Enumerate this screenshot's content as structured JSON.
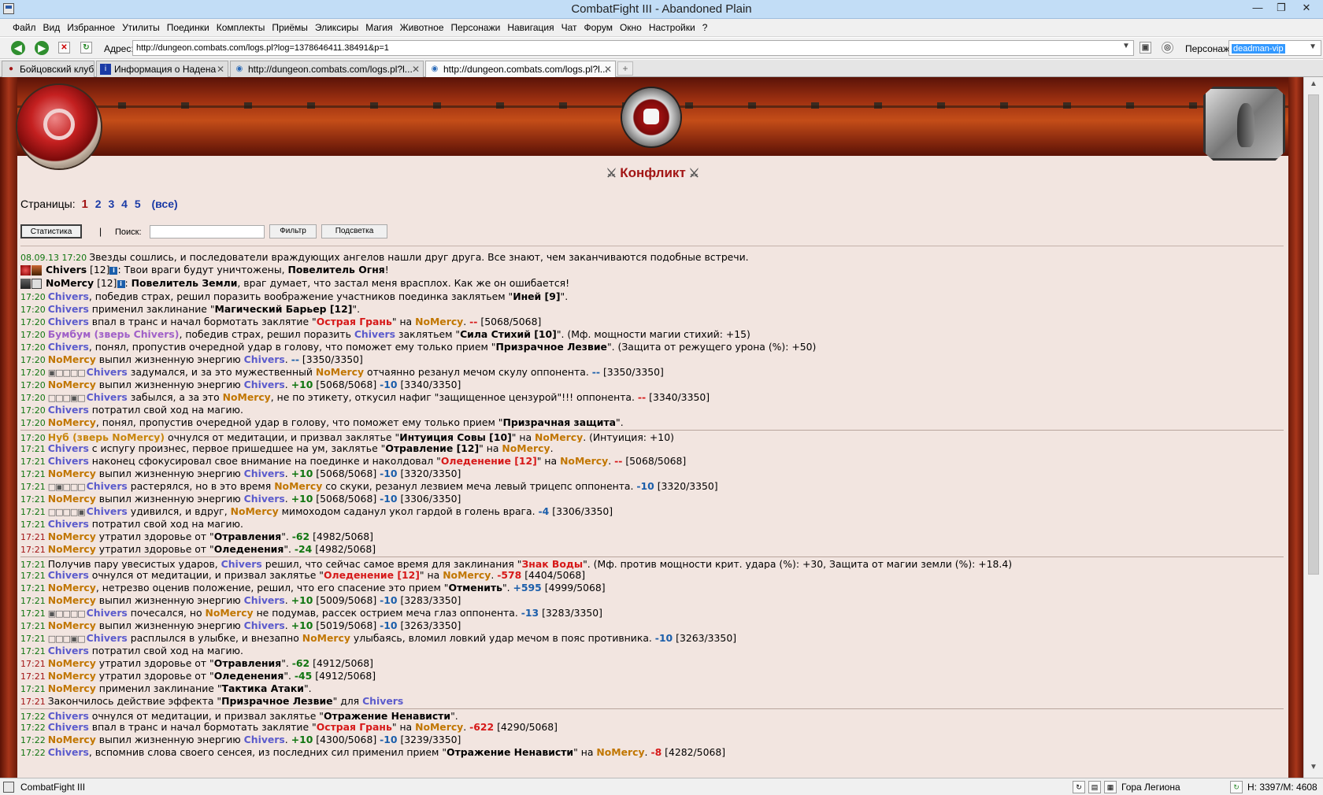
{
  "window": {
    "title": "CombatFight III - Abandoned Plain"
  },
  "menu": [
    "Файл",
    "Вид",
    "Избранное",
    "Утилиты",
    "Поединки",
    "Комплекты",
    "Приёмы",
    "Эликсиры",
    "Магия",
    "Животное",
    "Персонажи",
    "Навигация",
    "Чат",
    "Форум",
    "Окно",
    "Настройки",
    "?"
  ],
  "address": {
    "label": "Адрес:",
    "url": "http://dungeon.combats.com/logs.pl?log=1378646411.38491&p=1"
  },
  "persona": {
    "label": "Персонаж:",
    "value": "deadman-vip"
  },
  "tabs": [
    {
      "label": "Бойцовский клуб",
      "icon": "fist-icon"
    },
    {
      "label": "Информация о Надена",
      "icon": "info-icon"
    },
    {
      "label": "http://dungeon.combats.com/logs.pl?l...",
      "icon": "globe-icon"
    },
    {
      "label": "http://dungeon.combats.com/logs.pl?l...",
      "icon": "globe-icon"
    }
  ],
  "page": {
    "heading": "Конфликт",
    "pages_label": "Страницы:",
    "current_page": "1",
    "pages": [
      "2",
      "3",
      "4",
      "5"
    ],
    "all_pages": "(все)",
    "buttons": {
      "stats": "Статистика",
      "divider": "|",
      "search_label": "Поиск:",
      "filter": "Фильтр",
      "highlight": "Подсветка"
    },
    "search_value": ""
  },
  "log": {
    "first": {
      "ts": "08.09.13 17:20",
      "msg": "Звезды сошлись, и последователи враждующих ангелов нашли друг друга. Все знают, чем заканчиваются подобные встречи.",
      "chivers": {
        "name": "Chivers",
        "level": "[12]",
        "text1": ": Твои враги будут уничтожены, ",
        "title": "Повелитель Огня",
        "end": "!"
      },
      "nomercy": {
        "name": "NoMercy",
        "level": "[12]",
        "text1": ": ",
        "title": "Повелитель Земли",
        "text2": ", враг думает, что застал меня врасплох. Как же он ошибается!"
      }
    },
    "r1": {
      "t": "17:20",
      "a": "Chivers",
      "b": ", победив страх, решил поразить воображение участников поединка заклятьем \"",
      "c": "Иней [9]",
      "d": "\"."
    },
    "r2": {
      "t": "17:20",
      "a": "Chivers",
      "b": " применил заклинание \"",
      "c": "Магический Барьер [12]",
      "d": "\"."
    },
    "r3": {
      "t": "17:20",
      "a": "Chivers",
      "b": " впал в транс и начал бормотать заклятие \"",
      "c": "Острая Грань",
      "d": "\" на ",
      "e": "NoMercy",
      "f": ". ",
      "g": "--",
      "h": " [5068/5068]"
    },
    "r4": {
      "t": "17:20",
      "a": "Бумбум (зверь Chivers)",
      "b": ", победив страх, решил поразить ",
      "c": "Chivers",
      "d": " заклятьем \"",
      "e": "Сила Стихий [10]",
      "f": "\". (Мф. мощности магии стихий: +15)"
    },
    "r5": {
      "t": "17:20",
      "a": "Chivers",
      "b": ", понял, пропустив очередной удар в голову, что поможет ему только прием \"",
      "c": "Призрачное Лезвие",
      "d": "\". (Защита от режущего урона (%): +50)"
    },
    "r6": {
      "t": "17:20",
      "a": "NoMercy",
      "b": " выпил жизненную энергию ",
      "c": "Chivers",
      "d": ". ",
      "e": "--",
      "f": " [3350/3350]"
    },
    "r7": {
      "t": "17:20",
      "boxes": "▣□□□□",
      "a": "Chivers",
      "b": " задумался, и за это мужественный ",
      "c": "NoMercy",
      "d": " отчаянно резанул мечом скулу оппонента. ",
      "e": "--",
      "f": " [3350/3350]"
    },
    "r8": {
      "t": "17:20",
      "a": "NoMercy",
      "b": " выпил жизненную энергию ",
      "c": "Chivers",
      "d": ". ",
      "e": "+10",
      "f": " [5068/5068] ",
      "g": "-10",
      "h": " [3340/3350]"
    },
    "r9": {
      "t": "17:20",
      "boxes": "□□□▣□",
      "a": "Chivers",
      "b": " забылся, а за это ",
      "c": "NoMercy",
      "d": ", не по этикету, откусил нафиг \"защищенное цензурой\"!!! оппонента. ",
      "e": "--",
      "f": " [3340/3350]"
    },
    "r10": {
      "t": "17:20",
      "a": "Chivers",
      "b": " потратил свой ход на магию."
    },
    "r11": {
      "t": "17:20",
      "a": "NoMercy",
      "b": ", понял, пропустив очередной удар в голову, что поможет ему только прием \"",
      "c": "Призрачная защита",
      "d": "\"."
    },
    "r12": {
      "t": "17:20",
      "a": "Нуб (зверь NoMercy)",
      "b": " очнулся от медитации, и призвал заклятье \"",
      "c": "Интуиция Совы [10]",
      "d": "\" на ",
      "e": "NoMercy",
      "f": ". (Интуиция: +10)"
    },
    "r13": {
      "t": "17:21",
      "a": "Chivers",
      "b": " с испугу произнес, первое пришедшее на ум, заклятье \"",
      "c": "Отравление [12]",
      "d": "\" на ",
      "e": "NoMercy",
      "f": "."
    },
    "r14": {
      "t": "17:21",
      "a": "Chivers",
      "b": " наконец сфокусировал свое внимание на поединке и наколдовал \"",
      "c": "Оледенение [12]",
      "d": "\" на ",
      "e": "NoMercy",
      "f": ". ",
      "g": "--",
      "h": " [5068/5068]"
    },
    "r15": {
      "t": "17:21",
      "a": "NoMercy",
      "b": " выпил жизненную энергию ",
      "c": "Chivers",
      "d": ". ",
      "e": "+10",
      "f": " [5068/5068] ",
      "g": "-10",
      "h": " [3320/3350]"
    },
    "r16": {
      "t": "17:21",
      "boxes": "□▣□□□",
      "a": "Chivers",
      "b": " растерялся, но в это время ",
      "c": "NoMercy",
      "d": " со скуки, резанул лезвием меча левый трицепс оппонента. ",
      "e": "-10",
      "f": " [3320/3350]"
    },
    "r17": {
      "t": "17:21",
      "a": "NoMercy",
      "b": " выпил жизненную энергию ",
      "c": "Chivers",
      "d": ". ",
      "e": "+10",
      "f": " [5068/5068] ",
      "g": "-10",
      "h": " [3306/3350]"
    },
    "r18": {
      "t": "17:21",
      "boxes": "□□□□▣",
      "a": "Chivers",
      "b": " удивился, и вдруг, ",
      "c": "NoMercy",
      "d": " мимоходом саданул укол гардой в голень врага. ",
      "e": "-4",
      "f": " [3306/3350]"
    },
    "r19": {
      "t": "17:21",
      "a": "Chivers",
      "b": " потратил свой ход на магию."
    },
    "r20": {
      "t": "17:21",
      "a": "NoMercy",
      "b": " утратил здоровье от \"",
      "c": "Отравления",
      "d": "\". ",
      "e": "-62",
      "f": " [4982/5068]"
    },
    "r21": {
      "t": "17:21",
      "a": "NoMercy",
      "b": " утратил здоровье от \"",
      "c": "Оледенения",
      "d": "\". ",
      "e": "-24",
      "f": " [4982/5068]"
    },
    "r22": {
      "t": "17:21",
      "pre": "Получив пару увесистых ударов, ",
      "a": "Chivers",
      "b": " решил, что сейчас самое время для заклинания \"",
      "c": "Знак Воды",
      "d": "\". (Мф. против мощности крит. удара (%): +30, Защита от магии земли (%): +18.4)"
    },
    "r23": {
      "t": "17:21",
      "a": "Chivers",
      "b": " очнулся от медитации, и призвал заклятье \"",
      "c": "Оледенение [12]",
      "d": "\" на ",
      "e": "NoMercy",
      "f": ". ",
      "g": "-578",
      "h": " [4404/5068]"
    },
    "r24": {
      "t": "17:21",
      "a": "NoMercy",
      "b": ", нетрезво оценив положение, решил, что его спасение это прием \"",
      "c": "Отменить",
      "d": "\". ",
      "e": "+595",
      "f": " [4999/5068]"
    },
    "r25": {
      "t": "17:21",
      "a": "NoMercy",
      "b": " выпил жизненную энергию ",
      "c": "Chivers",
      "d": ". ",
      "e": "+10",
      "f": " [5009/5068] ",
      "g": "-10",
      "h": " [3283/3350]"
    },
    "r26": {
      "t": "17:21",
      "boxes": "▣□□□□",
      "a": "Chivers",
      "b": " почесался, но ",
      "c": "NoMercy",
      "d": " не подумав, рассек острием меча глаз оппонента. ",
      "e": "-13",
      "f": " [3283/3350]"
    },
    "r27": {
      "t": "17:21",
      "a": "NoMercy",
      "b": " выпил жизненную энергию ",
      "c": "Chivers",
      "d": ". ",
      "e": "+10",
      "f": " [5019/5068] ",
      "g": "-10",
      "h": " [3263/3350]"
    },
    "r28": {
      "t": "17:21",
      "boxes": "□□□▣□",
      "a": "Chivers",
      "b": " расплылся в улыбке, и внезапно ",
      "c": "NoMercy",
      "d": " улыбаясь, вломил ловкий удар мечом в пояс противника. ",
      "e": "-10",
      "f": " [3263/3350]"
    },
    "r29": {
      "t": "17:21",
      "a": "Chivers",
      "b": " потратил свой ход на магию."
    },
    "r30": {
      "t": "17:21",
      "a": "NoMercy",
      "b": " утратил здоровье от \"",
      "c": "Отравления",
      "d": "\". ",
      "e": "-62",
      "f": " [4912/5068]"
    },
    "r31": {
      "t": "17:21",
      "a": "NoMercy",
      "b": " утратил здоровье от \"",
      "c": "Оледенения",
      "d": "\". ",
      "e": "-45",
      "f": " [4912/5068]"
    },
    "r32": {
      "t": "17:21",
      "a": "NoMercy",
      "b": " применил заклинание \"",
      "c": "Тактика Атаки",
      "d": "\"."
    },
    "r33": {
      "t": "17:21",
      "pre": "Закончилось действие эффекта \"",
      "c": "Призрачное Лезвие",
      "d": "\" для ",
      "a": "Chivers"
    },
    "r34": {
      "t": "17:22",
      "a": "Chivers",
      "b": " очнулся от медитации, и призвал заклятье \"",
      "c": "Отражение Ненависти",
      "d": "\"."
    },
    "r35": {
      "t": "17:22",
      "a": "Chivers",
      "b": " впал в транс и начал бормотать заклятие \"",
      "c": "Острая Грань",
      "d": "\" на ",
      "e": "NoMercy",
      "f": ". ",
      "g": "-622",
      "h": " [4290/5068]"
    },
    "r36": {
      "t": "17:22",
      "a": "NoMercy",
      "b": " выпил жизненную энергию ",
      "c": "Chivers",
      "d": ". ",
      "e": "+10",
      "f": " [4300/5068] ",
      "g": "-10",
      "h": " [3239/3350]"
    },
    "r37": {
      "t": "17:22",
      "a": "Chivers",
      "b": ", вспомнив слова своего сенсея, из последних сил применил прием \"",
      "c": "Отражение Ненависти",
      "d": "\" на ",
      "e": "NoMercy",
      "f": ". ",
      "g": "-8",
      "h": " [4282/5068]"
    }
  },
  "status": {
    "app": "CombatFight III",
    "location": "Гора Легиона",
    "hp": "H: 3397/M: 4608"
  }
}
